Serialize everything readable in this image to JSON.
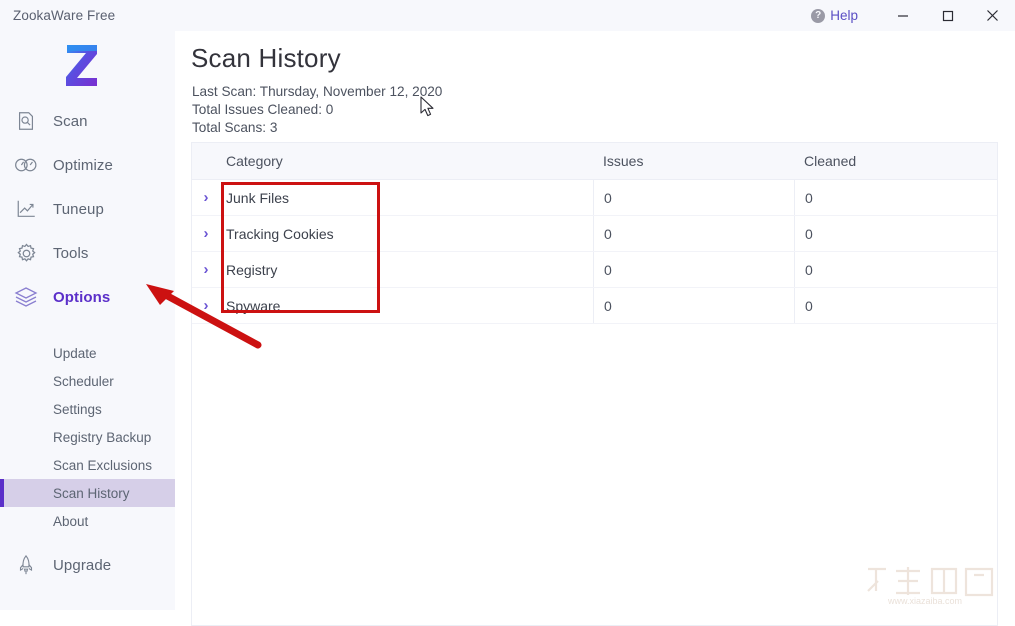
{
  "window": {
    "app_title": "ZookaWare Free",
    "help_label": "Help",
    "help_icon": "question-circle-icon",
    "minimize_label": "─",
    "maximize_label": "□",
    "close_label": "✕"
  },
  "sidebar": {
    "logo_letter": "Z",
    "nav": [
      {
        "label": "Scan",
        "icon": "scan-document-icon",
        "active": false
      },
      {
        "label": "Optimize",
        "icon": "gauge-icon",
        "active": false
      },
      {
        "label": "Tuneup",
        "icon": "line-chart-icon",
        "active": false
      },
      {
        "label": "Tools",
        "icon": "gear-icon",
        "active": false
      },
      {
        "label": "Options",
        "icon": "layers-icon",
        "active": true
      }
    ],
    "sub_items": [
      {
        "label": "Update",
        "selected": false
      },
      {
        "label": "Scheduler",
        "selected": false
      },
      {
        "label": "Settings",
        "selected": false
      },
      {
        "label": "Registry Backup",
        "selected": false
      },
      {
        "label": "Scan Exclusions",
        "selected": false
      },
      {
        "label": "Scan History",
        "selected": true
      },
      {
        "label": "About",
        "selected": false
      }
    ],
    "upgrade": {
      "label": "Upgrade",
      "icon": "rocket-icon"
    }
  },
  "main": {
    "page_title": "Scan History",
    "meta": [
      "Last Scan: Thursday, November 12, 2020",
      "Total Issues Cleaned: 0",
      "Total Scans: 3"
    ],
    "table": {
      "columns": [
        "Category",
        "Issues",
        "Cleaned"
      ],
      "rows": [
        {
          "chevron": "›",
          "category": "Junk Files",
          "issues": "0",
          "cleaned": "0"
        },
        {
          "chevron": "›",
          "category": "Tracking Cookies",
          "issues": "0",
          "cleaned": "0"
        },
        {
          "chevron": "›",
          "category": "Registry",
          "issues": "0",
          "cleaned": "0"
        },
        {
          "chevron": "›",
          "category": "Spyware",
          "issues": "0",
          "cleaned": "0"
        }
      ]
    }
  },
  "annotations": {
    "highlight_color": "#cc1111",
    "arrow_color": "#cc1111"
  },
  "watermark": {
    "site": "www.xiazaiba.com",
    "text": "下载吧"
  },
  "colors": {
    "accent": "#5b2fc9",
    "chevron": "#6b55d4",
    "sidebar_bg": "#f7f8fc",
    "selected_bg": "#d6cfe8",
    "text": "#5d6573"
  }
}
